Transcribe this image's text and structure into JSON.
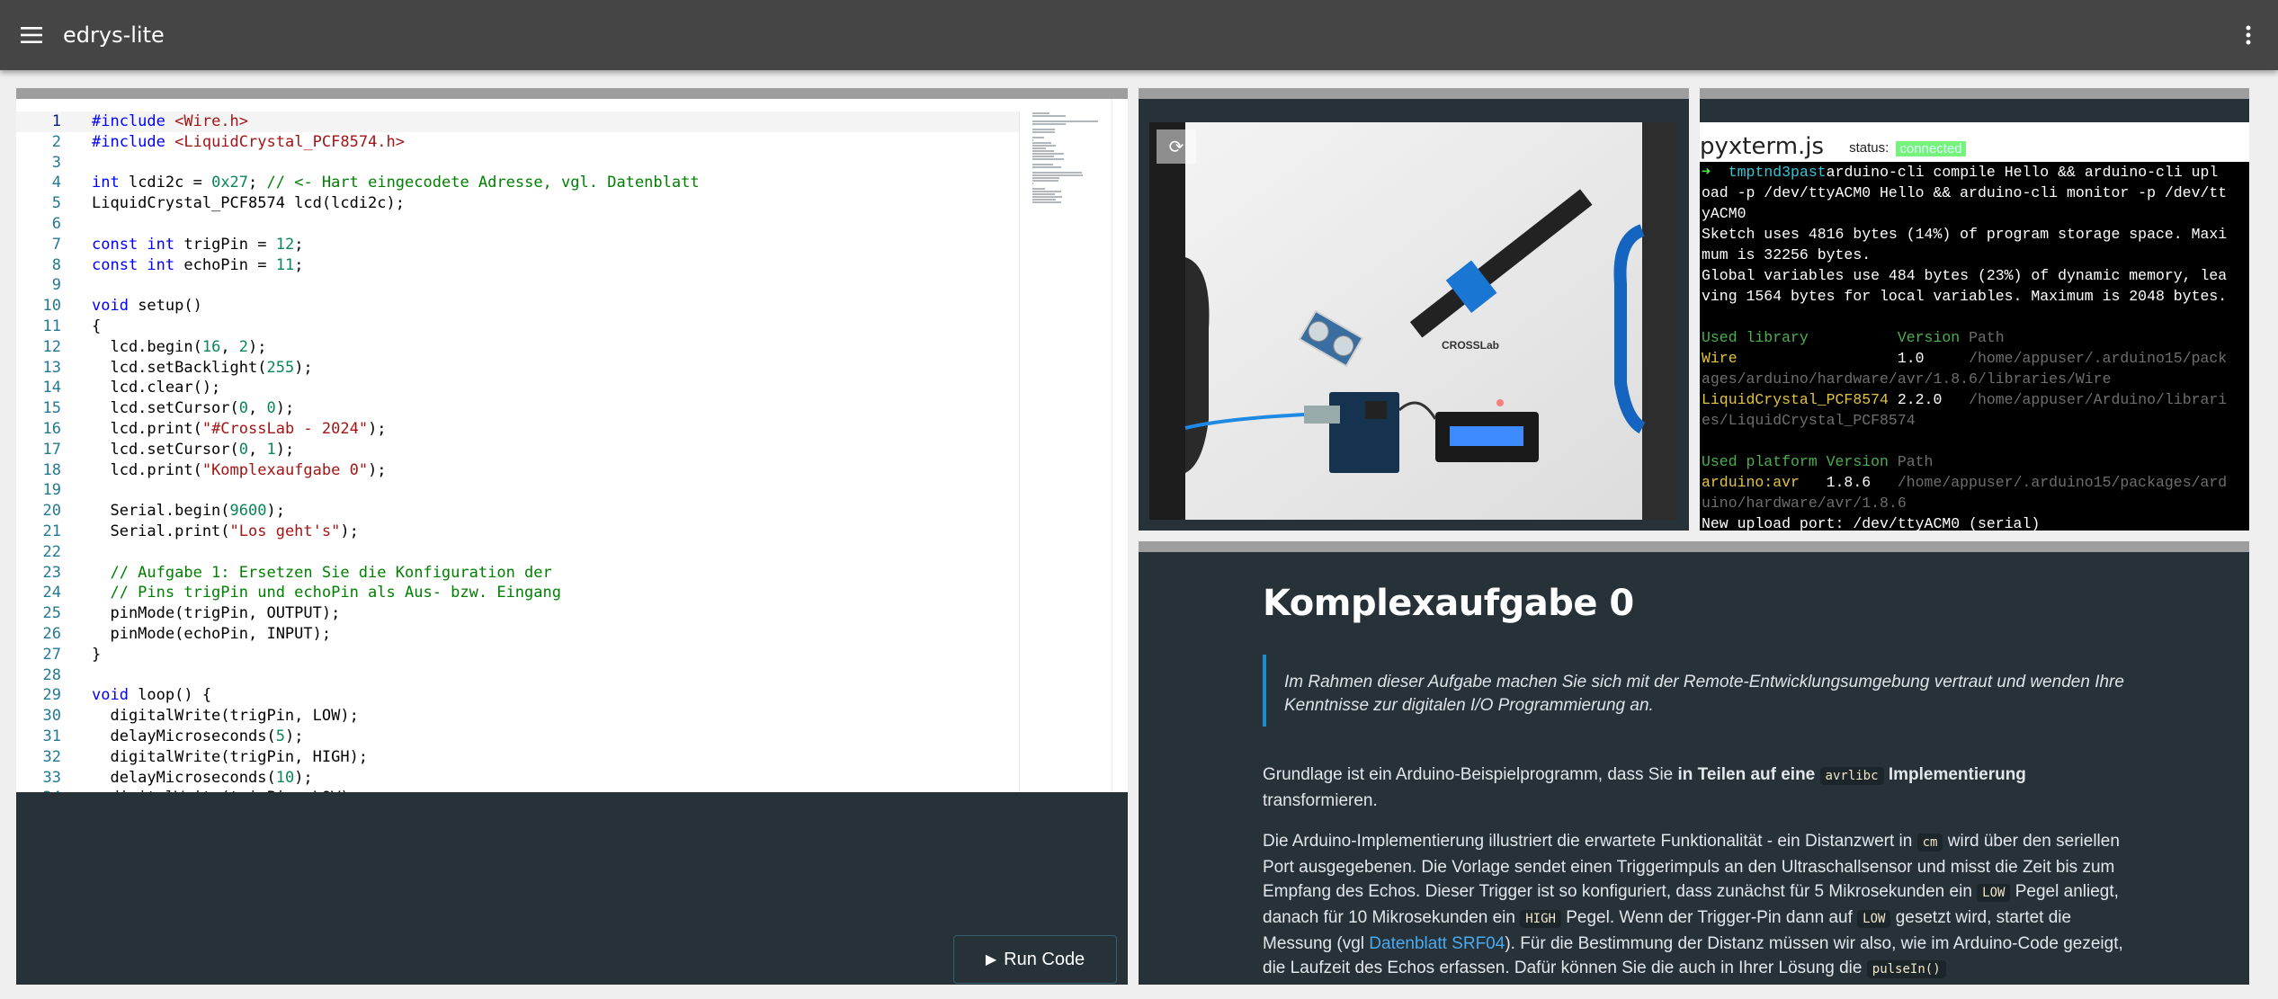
{
  "app": {
    "title": "edrys-lite",
    "menu_icon": "hamburger-icon",
    "more_icon": "kebab-vertical-icon"
  },
  "editor": {
    "active_line": 1,
    "lines": [
      [
        [
          "kw",
          "#include"
        ],
        [
          "tx",
          " "
        ],
        [
          "str",
          "<Wire.h>"
        ]
      ],
      [
        [
          "kw",
          "#include"
        ],
        [
          "tx",
          " "
        ],
        [
          "str",
          "<LiquidCrystal_PCF8574.h>"
        ]
      ],
      [],
      [
        [
          "kw",
          "int"
        ],
        [
          "tx",
          " lcdi2c = "
        ],
        [
          "num",
          "0x27"
        ],
        [
          "tx",
          "; "
        ],
        [
          "cm",
          "// <- Hart eingecodete Adresse, vgl. Datenblatt"
        ]
      ],
      [
        [
          "tx",
          "LiquidCrystal_PCF8574 lcd(lcdi2c);"
        ]
      ],
      [],
      [
        [
          "kw",
          "const int"
        ],
        [
          "tx",
          " trigPin = "
        ],
        [
          "num",
          "12"
        ],
        [
          "tx",
          ";"
        ]
      ],
      [
        [
          "kw",
          "const int"
        ],
        [
          "tx",
          " echoPin = "
        ],
        [
          "num",
          "11"
        ],
        [
          "tx",
          ";"
        ]
      ],
      [],
      [
        [
          "kw",
          "void"
        ],
        [
          "tx",
          " setup()"
        ]
      ],
      [
        [
          "tx",
          "{"
        ]
      ],
      [
        [
          "tx",
          "  lcd.begin("
        ],
        [
          "num",
          "16"
        ],
        [
          "tx",
          ", "
        ],
        [
          "num",
          "2"
        ],
        [
          "tx",
          ");"
        ]
      ],
      [
        [
          "tx",
          "  lcd.setBacklight("
        ],
        [
          "num",
          "255"
        ],
        [
          "tx",
          ");"
        ]
      ],
      [
        [
          "tx",
          "  lcd.clear();"
        ]
      ],
      [
        [
          "tx",
          "  lcd.setCursor("
        ],
        [
          "num",
          "0"
        ],
        [
          "tx",
          ", "
        ],
        [
          "num",
          "0"
        ],
        [
          "tx",
          ");"
        ]
      ],
      [
        [
          "tx",
          "  lcd.print("
        ],
        [
          "str",
          "\"#CrossLab - 2024\""
        ],
        [
          "tx",
          ");"
        ]
      ],
      [
        [
          "tx",
          "  lcd.setCursor("
        ],
        [
          "num",
          "0"
        ],
        [
          "tx",
          ", "
        ],
        [
          "num",
          "1"
        ],
        [
          "tx",
          ");"
        ]
      ],
      [
        [
          "tx",
          "  lcd.print("
        ],
        [
          "str",
          "\"Komplexaufgabe 0\""
        ],
        [
          "tx",
          ");"
        ]
      ],
      [],
      [
        [
          "tx",
          "  Serial.begin("
        ],
        [
          "num",
          "9600"
        ],
        [
          "tx",
          ");"
        ]
      ],
      [
        [
          "tx",
          "  Serial.print("
        ],
        [
          "str",
          "\"Los geht's\""
        ],
        [
          "tx",
          ");"
        ]
      ],
      [],
      [
        [
          "cm",
          "  // Aufgabe 1: Ersetzen Sie die Konfiguration der"
        ]
      ],
      [
        [
          "cm",
          "  // Pins trigPin und echoPin als Aus- bzw. Eingang"
        ]
      ],
      [
        [
          "tx",
          "  pinMode(trigPin, OUTPUT);"
        ]
      ],
      [
        [
          "tx",
          "  pinMode(echoPin, INPUT);"
        ]
      ],
      [
        [
          "tx",
          "}"
        ]
      ],
      [],
      [
        [
          "kw",
          "void"
        ],
        [
          "tx",
          " loop() {"
        ]
      ],
      [
        [
          "tx",
          "  digitalWrite(trigPin, LOW);"
        ]
      ],
      [
        [
          "tx",
          "  delayMicroseconds("
        ],
        [
          "num",
          "5"
        ],
        [
          "tx",
          ");"
        ]
      ],
      [
        [
          "tx",
          "  digitalWrite(trigPin, HIGH);"
        ]
      ],
      [
        [
          "tx",
          "  delayMicroseconds("
        ],
        [
          "num",
          "10"
        ],
        [
          "tx",
          ");"
        ]
      ],
      [
        [
          "tx",
          "  digitalWrite(trigPin, LOW);"
        ]
      ]
    ],
    "run_label": "Run Code",
    "run_icon": "play-icon"
  },
  "camera": {
    "reload_icon": "reload-icon",
    "reload_glyph": "⟳",
    "board_label": "CROSSLab"
  },
  "terminal": {
    "name": "pyxterm.js",
    "status_label": "status:",
    "status_value": "connected",
    "status_color": "#77f27a",
    "lines": [
      [
        [
          "t-arrow",
          "➜  "
        ],
        [
          "t-cyan",
          "tmptnd3past"
        ],
        [
          "",
          "arduino-cli compile Hello && arduino-cli upl"
        ]
      ],
      [
        [
          "",
          "oad -p /dev/ttyACM0 Hello && arduino-cli monitor -p /dev/tt"
        ]
      ],
      [
        [
          "",
          "yACM0"
        ]
      ],
      [
        [
          "",
          "Sketch uses 4816 bytes (14%) of program storage space. Maxi"
        ]
      ],
      [
        [
          "",
          "mum is 32256 bytes."
        ]
      ],
      [
        [
          "",
          "Global variables use 484 bytes (23%) of dynamic memory, lea"
        ]
      ],
      [
        [
          "",
          "ving 1564 bytes for local variables. Maximum is 2048 bytes."
        ]
      ],
      [],
      [
        [
          "t-green",
          "Used library          Version "
        ],
        [
          "t-dim",
          "Path"
        ]
      ],
      [
        [
          "t-yellow",
          "Wire                  "
        ],
        [
          "",
          "1.0     "
        ],
        [
          "t-dim",
          "/home/appuser/.arduino15/pack"
        ]
      ],
      [
        [
          "t-dim",
          "ages/arduino/hardware/avr/1.8.6/libraries/Wire"
        ]
      ],
      [
        [
          "t-yellow",
          "LiquidCrystal_PCF8574 "
        ],
        [
          "",
          "2.2.0   "
        ],
        [
          "t-dim",
          "/home/appuser/Arduino/librari"
        ]
      ],
      [
        [
          "t-dim",
          "es/LiquidCrystal_PCF8574"
        ]
      ],
      [],
      [
        [
          "t-green",
          "Used platform Version "
        ],
        [
          "t-dim",
          "Path"
        ]
      ],
      [
        [
          "t-yellow",
          "arduino:avr   "
        ],
        [
          "",
          "1.8.6   "
        ],
        [
          "t-dim",
          "/home/appuser/.arduino15/packages/ard"
        ]
      ],
      [
        [
          "t-dim",
          "uino/hardware/avr/1.8.6"
        ]
      ],
      [
        [
          "",
          "New upload port: /dev/ttyACM0 (serial)"
        ]
      ]
    ]
  },
  "doc": {
    "title": "Komplexaufgabe 0",
    "quote": "Im Rahmen dieser Aufgabe machen Sie sich mit der Remote-Entwicklungsumgebung vertraut und wenden Ihre Kenntnisse zur digitalen I/O Programmierung an.",
    "p1_a": "Grundlage ist ein Arduino-Beispielprogramm, dass Sie ",
    "p1_b": "in Teilen auf eine ",
    "p1_code": "avrlibc",
    "p1_c": " Implementierung",
    "p1_d": " transformieren.",
    "p2_a": "Die Arduino-Implementierung illustriert die erwartete Funktionalität - ein Distanzwert in ",
    "p2_code1": "cm",
    "p2_b": " wird über den seriellen Port ausgegebenen. Die Vorlage sendet einen Triggerimpuls an den Ultraschallsensor und misst die Zeit bis zum Empfang des Echos. Dieser Trigger ist so konfiguriert, dass zunächst für 5 Mikrosekunden ein ",
    "p2_code2": "LOW",
    "p2_c": " Pegel anliegt, danach für 10 Mikrosekunden ein ",
    "p2_code3": "HIGH",
    "p2_d": " Pegel. Wenn der Trigger-Pin dann auf ",
    "p2_code4": "LOW",
    "p2_e": " gesetzt wird, startet die Messung (vgl ",
    "p2_link": "Datenblatt SRF04",
    "p2_f": "). Für die Bestimmung der Distanz müssen wir also, wie im Arduino-Code gezeigt, die Laufzeit des Echos erfassen. Dafür können Sie die auch in Ihrer Lösung die ",
    "p2_code5": "pulseIn()"
  }
}
